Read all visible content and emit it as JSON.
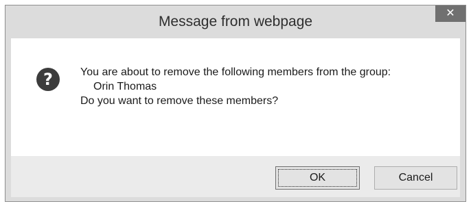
{
  "dialog": {
    "title": "Message from webpage",
    "close_glyph": "✕",
    "icon": "question-icon",
    "icon_glyph": "?",
    "message": {
      "line1": "You are about to remove the following members from the group:",
      "member": "Orin Thomas",
      "line3": "Do you want to remove these members?"
    },
    "buttons": {
      "ok_label": "OK",
      "cancel_label": "Cancel"
    }
  },
  "colors": {
    "titlebar": "#dcdcdc",
    "close_button": "#707070",
    "content": "#ffffff",
    "footer": "#ebebeb",
    "icon": "#3c3c3c"
  }
}
